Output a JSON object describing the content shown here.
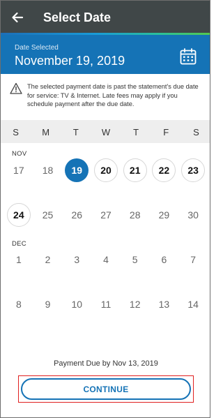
{
  "appbar": {
    "title": "Select Date",
    "back_icon": "arrow-left-icon"
  },
  "header": {
    "date_label": "Date Selected",
    "date_value": "November 19, 2019",
    "calendar_icon": "calendar-icon"
  },
  "warning": {
    "icon": "warning-triangle-icon",
    "text": "The selected payment date is past the statement's due date for service: TV & Internet. Late fees may apply if you schedule payment after the due date."
  },
  "weekdays": [
    "S",
    "M",
    "T",
    "W",
    "T",
    "F",
    "S"
  ],
  "calendar": {
    "nov": {
      "label": "NOV",
      "row1": [
        "17",
        "18",
        "19",
        "20",
        "21",
        "22",
        "23"
      ],
      "row2": [
        "24",
        "25",
        "26",
        "27",
        "28",
        "29",
        "30"
      ]
    },
    "dec": {
      "label": "DEC",
      "row1": [
        "1",
        "2",
        "3",
        "4",
        "5",
        "6",
        "7"
      ],
      "row2": [
        "8",
        "9",
        "10",
        "11",
        "12",
        "13",
        "14"
      ]
    },
    "selected_day": "19"
  },
  "footer": {
    "payment_due": "Payment Due by Nov 13, 2019",
    "continue_label": "CONTINUE"
  },
  "colors": {
    "appbar": "#404748",
    "primary": "#1573b6",
    "weekday_bg": "#eeeeee",
    "highlight": "#e02020"
  }
}
